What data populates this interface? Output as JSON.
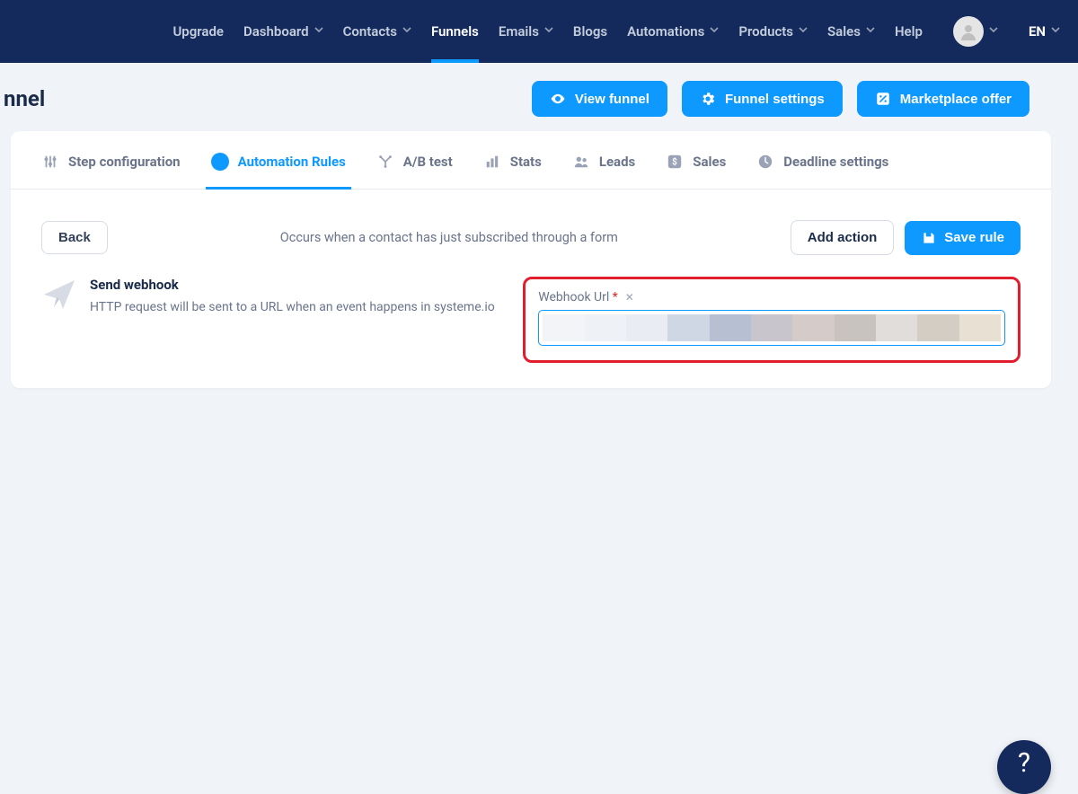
{
  "nav": {
    "items": [
      {
        "label": "Upgrade",
        "dropdown": false
      },
      {
        "label": "Dashboard",
        "dropdown": true
      },
      {
        "label": "Contacts",
        "dropdown": true
      },
      {
        "label": "Funnels",
        "dropdown": false,
        "active": true
      },
      {
        "label": "Emails",
        "dropdown": true
      },
      {
        "label": "Blogs",
        "dropdown": false
      },
      {
        "label": "Automations",
        "dropdown": true
      },
      {
        "label": "Products",
        "dropdown": true
      },
      {
        "label": "Sales",
        "dropdown": true
      },
      {
        "label": "Help",
        "dropdown": false
      }
    ],
    "lang": "EN"
  },
  "page": {
    "title_fragment": "nnel",
    "buttons": {
      "view_funnel": "View funnel",
      "funnel_settings": "Funnel settings",
      "marketplace_offer": "Marketplace offer"
    }
  },
  "tabs": [
    {
      "label": "Step configuration",
      "icon": "sliders"
    },
    {
      "label": "Automation Rules",
      "icon": "bolt",
      "active": true
    },
    {
      "label": "A/B test",
      "icon": "split"
    },
    {
      "label": "Stats",
      "icon": "bars"
    },
    {
      "label": "Leads",
      "icon": "people"
    },
    {
      "label": "Sales",
      "icon": "dollar"
    },
    {
      "label": "Deadline settings",
      "icon": "clock"
    }
  ],
  "actions": {
    "back": "Back",
    "occurs": "Occurs when a contact has just subscribed through a form",
    "add_action": "Add action",
    "save_rule": "Save rule"
  },
  "rule": {
    "title": "Send webhook",
    "desc": "HTTP request will be sent to a URL when an event happens in systeme.io",
    "field_label": "Webhook Url",
    "blur_colors": [
      "#f2f4f7",
      "#eef1f5",
      "#e9ecf2",
      "#d0d7e4",
      "#b7bfd3",
      "#c8c5cd",
      "#d5cbc9",
      "#c9c3c0",
      "#e1ddda",
      "#d4cdc3",
      "#e9e0d4"
    ]
  },
  "fab": "?"
}
